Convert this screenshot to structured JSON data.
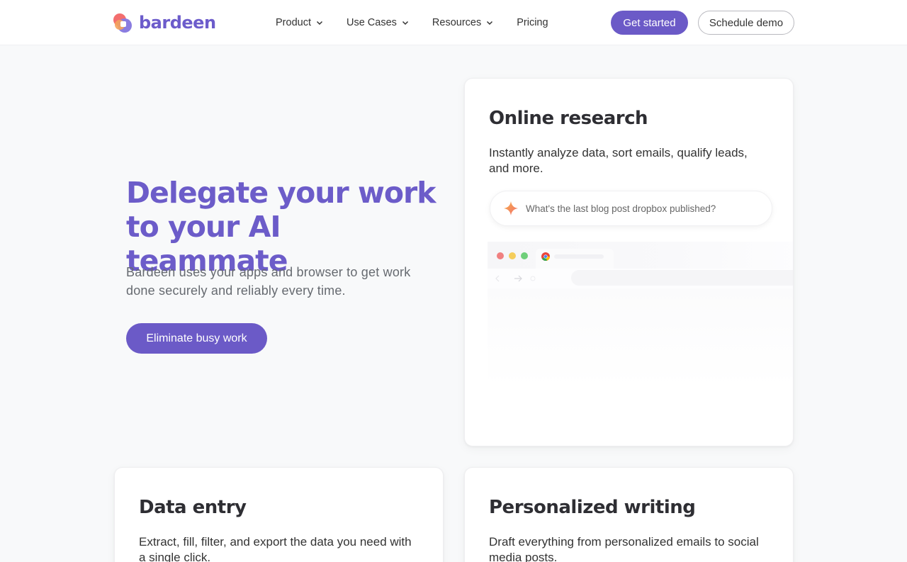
{
  "header": {
    "logo_text": "bardeen",
    "nav": [
      {
        "label": "Product",
        "has_dropdown": true
      },
      {
        "label": "Use Cases",
        "has_dropdown": true
      },
      {
        "label": "Resources",
        "has_dropdown": true
      },
      {
        "label": "Pricing",
        "has_dropdown": false
      }
    ],
    "get_started": "Get started",
    "schedule_demo": "Schedule demo"
  },
  "hero": {
    "title": "Delegate your work to your AI teammate",
    "subtitle": "Bardeen uses your apps and browser to get work done securely and reliably every time.",
    "cta": "Eliminate busy work"
  },
  "cards": {
    "research": {
      "title": "Online research",
      "description": "Instantly analyze data, sort emails, qualify leads, and more.",
      "prompt": "What's the last blog post dropbox published?"
    },
    "entry": {
      "title": "Data entry",
      "description": "Extract, fill, filter, and export the data you need with a single click."
    },
    "writing": {
      "title": "Personalized writing",
      "description": "Draft everything from personalized emails to social media posts."
    }
  },
  "colors": {
    "brand": "#6b5ac7",
    "background": "#f8f9fa",
    "traffic_red": "#f08080",
    "traffic_yellow": "#f5cd5b",
    "traffic_green": "#6fcf7a"
  },
  "icons": {
    "logo": "bardeen-logo-icon",
    "chevron": "chevron-down-icon",
    "sparkle": "sparkle-icon",
    "browser": "chrome-icon"
  }
}
